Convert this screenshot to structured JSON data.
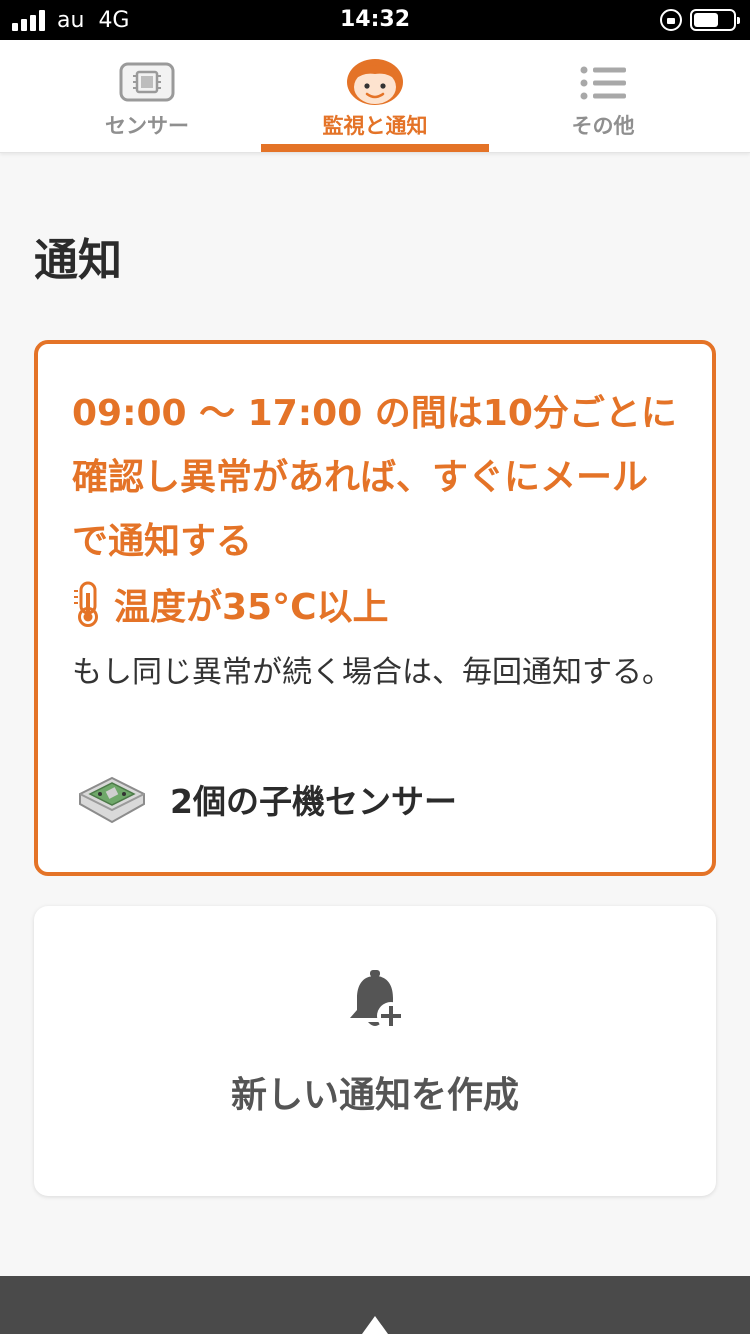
{
  "status_bar": {
    "carrier": "au",
    "network": "4G",
    "time": "14:32"
  },
  "tabs": [
    {
      "label": "センサー",
      "icon": "sensor-chip-icon",
      "active": false
    },
    {
      "label": "監視と通知",
      "icon": "mascot-face-icon",
      "active": true
    },
    {
      "label": "その他",
      "icon": "list-menu-icon",
      "active": false
    }
  ],
  "colors": {
    "accent": "#e47327",
    "status_bar_bg": "#000000",
    "bottom_bar_bg": "#4a4a4a"
  },
  "page": {
    "title": "通知"
  },
  "rule_card": {
    "headline": "09:00 〜 17:00 の間は10分ごとに確認し異常があれば、すぐにメールで通知する",
    "condition_icon": "thermometer-icon",
    "condition": "温度が35°C以上",
    "note": "もし同じ異常が続く場合は、毎回通知する。",
    "sensor_icon": "sensor-device-icon",
    "sensors": "2個の子機センサー"
  },
  "new_card": {
    "icon": "bell-add-icon",
    "label": "新しい通知を作成"
  },
  "bottom_bar": {
    "icon": "scroll-up-icon"
  }
}
